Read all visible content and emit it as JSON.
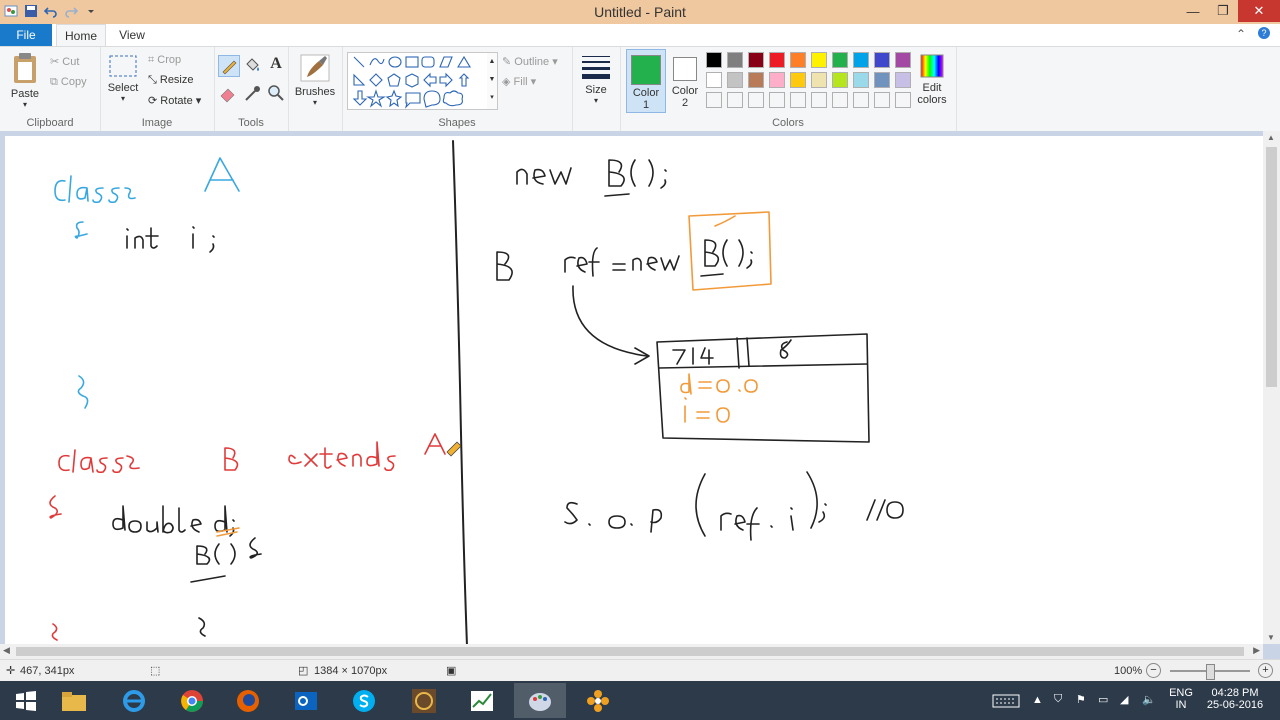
{
  "window": {
    "title": "Untitled - Paint"
  },
  "tabs": {
    "file": "File",
    "home": "Home",
    "view": "View"
  },
  "clipboard": {
    "paste": "Paste",
    "cut": "Cut",
    "copy": "Copy",
    "label": "Clipboard"
  },
  "image": {
    "select": "Select",
    "crop": "Crop",
    "resize": "Resize",
    "rotate": "Rotate",
    "label": "Image"
  },
  "tools": {
    "label": "Tools"
  },
  "brushes": {
    "label": "Brushes"
  },
  "shapes": {
    "outline": "Outline",
    "fill": "Fill",
    "label": "Shapes"
  },
  "size": {
    "label": "Size"
  },
  "colors": {
    "color1_a": "Color",
    "color1_b": "1",
    "color2_a": "Color",
    "color2_b": "2",
    "edit_a": "Edit",
    "edit_b": "colors",
    "label": "Colors",
    "color1": "#22b14c",
    "palette_row1": [
      "#000000",
      "#7f7f7f",
      "#880015",
      "#ed1c24",
      "#ff7f27",
      "#fff200",
      "#22b14c",
      "#00a2e8",
      "#3f48cc",
      "#a349a4"
    ],
    "palette_row2": [
      "#ffffff",
      "#c3c3c3",
      "#b97a57",
      "#ffaec9",
      "#ffc90e",
      "#efe4b0",
      "#b5e61d",
      "#99d9ea",
      "#7092be",
      "#c8bfe7"
    ]
  },
  "status": {
    "cursor": "467, 341px",
    "size": "1384 × 1070px",
    "zoom": "100%"
  },
  "tray": {
    "lang1": "ENG",
    "lang2": "IN",
    "time": "04:28 PM",
    "date": "25-06-2016"
  },
  "ink": {
    "blue": "#38a8e0",
    "red": "#e03a3a",
    "orange": "#f29a3a",
    "black": "#222222"
  }
}
